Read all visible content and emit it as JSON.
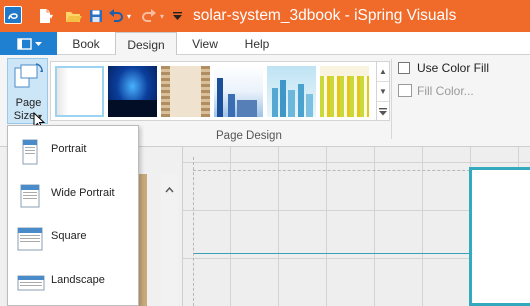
{
  "window": {
    "title": "solar-system_3dbook - iSpring Visuals",
    "accent": "#f06a2a",
    "file_button_color": "#1f7fd0"
  },
  "quick_access": [
    "new-document-icon",
    "open-folder-icon",
    "save-icon",
    "undo-icon",
    "redo-icon",
    "customize-dropdown-icon"
  ],
  "tabs": [
    {
      "label": "Book"
    },
    {
      "label": "Design"
    },
    {
      "label": "View"
    },
    {
      "label": "Help"
    }
  ],
  "ribbon": {
    "page_size": {
      "line1": "Page",
      "line2": "Size"
    },
    "gallery_thumbnails": [
      "plain-white",
      "dark-blue-space",
      "beige-pattern",
      "blue-city",
      "skyline",
      "green-stripes"
    ],
    "use_color_fill": "Use Color Fill",
    "fill_color": "Fill Color...",
    "group_label": "Page Design"
  },
  "page_size_menu": [
    {
      "label": "Portrait",
      "icon": "portrait-page-icon"
    },
    {
      "label": "Wide Portrait",
      "icon": "wide-portrait-page-icon"
    },
    {
      "label": "Square",
      "icon": "square-page-icon"
    },
    {
      "label": "Landscape",
      "icon": "landscape-page-icon"
    }
  ]
}
